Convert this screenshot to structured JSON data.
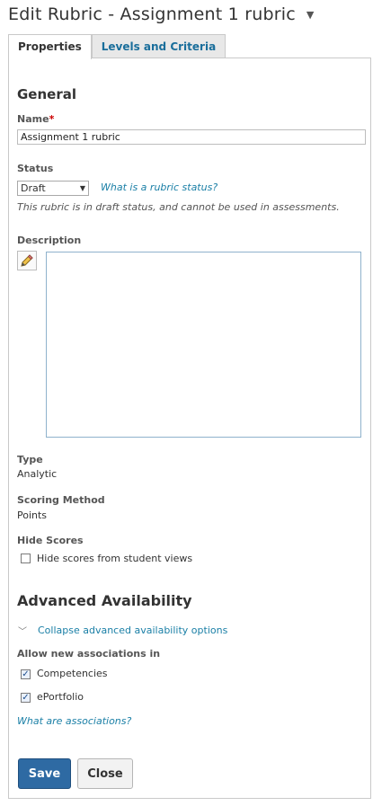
{
  "page": {
    "title": "Edit Rubric - Assignment 1 rubric",
    "title_menu_icon": "caret-down-icon"
  },
  "tabs": [
    {
      "label": "Properties",
      "active": true
    },
    {
      "label": "Levels and Criteria",
      "active": false
    }
  ],
  "general": {
    "heading": "General",
    "name_label": "Name",
    "required_marker": "*",
    "name_value": "Assignment 1 rubric",
    "status_label": "Status",
    "status_value": "Draft",
    "status_help_link": "What is a rubric status?",
    "status_note": "This rubric is in draft status, and cannot be used in assessments.",
    "description_label": "Description",
    "description_value": "",
    "type_label": "Type",
    "type_value": "Analytic",
    "scoring_label": "Scoring Method",
    "scoring_value": "Points",
    "hide_scores_label": "Hide Scores",
    "hide_scores_option": "Hide scores from student views",
    "hide_scores_checked": false
  },
  "advanced": {
    "heading": "Advanced Availability",
    "collapse_link": "Collapse advanced availability options",
    "allow_label": "Allow new associations in",
    "options": [
      {
        "label": "Competencies",
        "checked": true
      },
      {
        "label": "ePortfolio",
        "checked": true
      }
    ],
    "help_link": "What are associations?"
  },
  "actions": {
    "save_label": "Save",
    "close_label": "Close"
  },
  "colors": {
    "link": "#1a7fa6",
    "primary_button": "#2e6aa3",
    "required": "#cc0000"
  }
}
